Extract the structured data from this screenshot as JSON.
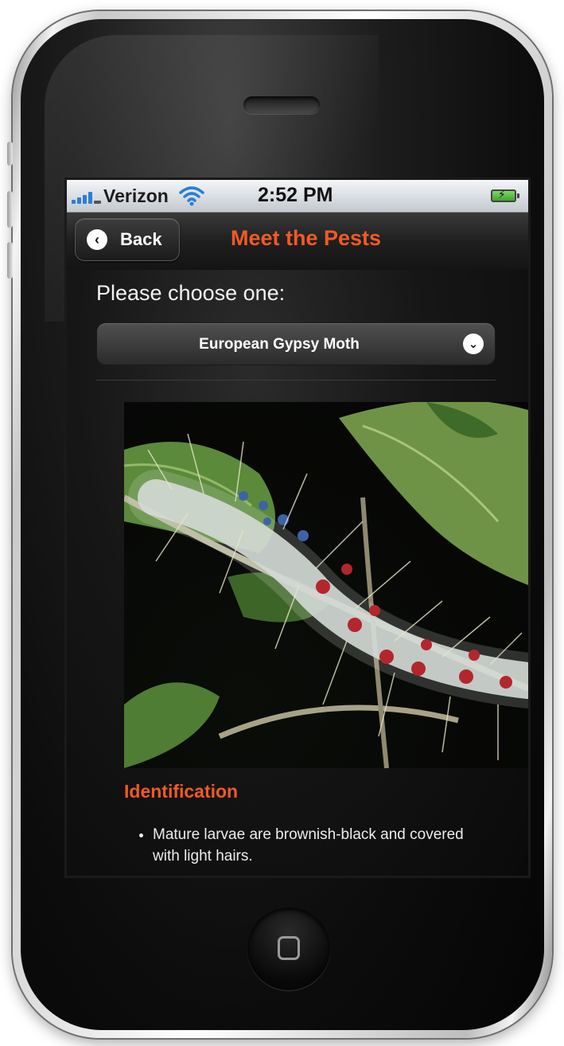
{
  "status_bar": {
    "carrier": "Verizon",
    "time": "2:52 PM"
  },
  "nav_bar": {
    "back_label": "Back",
    "title": "Meet the Pests"
  },
  "page": {
    "prompt": "Please choose one:",
    "pest_select": {
      "selected": "European Gypsy Moth"
    },
    "photo_icon": "caterpillar-on-leaf-image",
    "section_title": "Identification",
    "bullets": [
      "Mature larvae are brownish-black and covered with light hairs."
    ]
  },
  "colors": {
    "accent": "#f15a24",
    "screen_background": "#0b0b0b",
    "status_bar": "#d9dde2"
  }
}
